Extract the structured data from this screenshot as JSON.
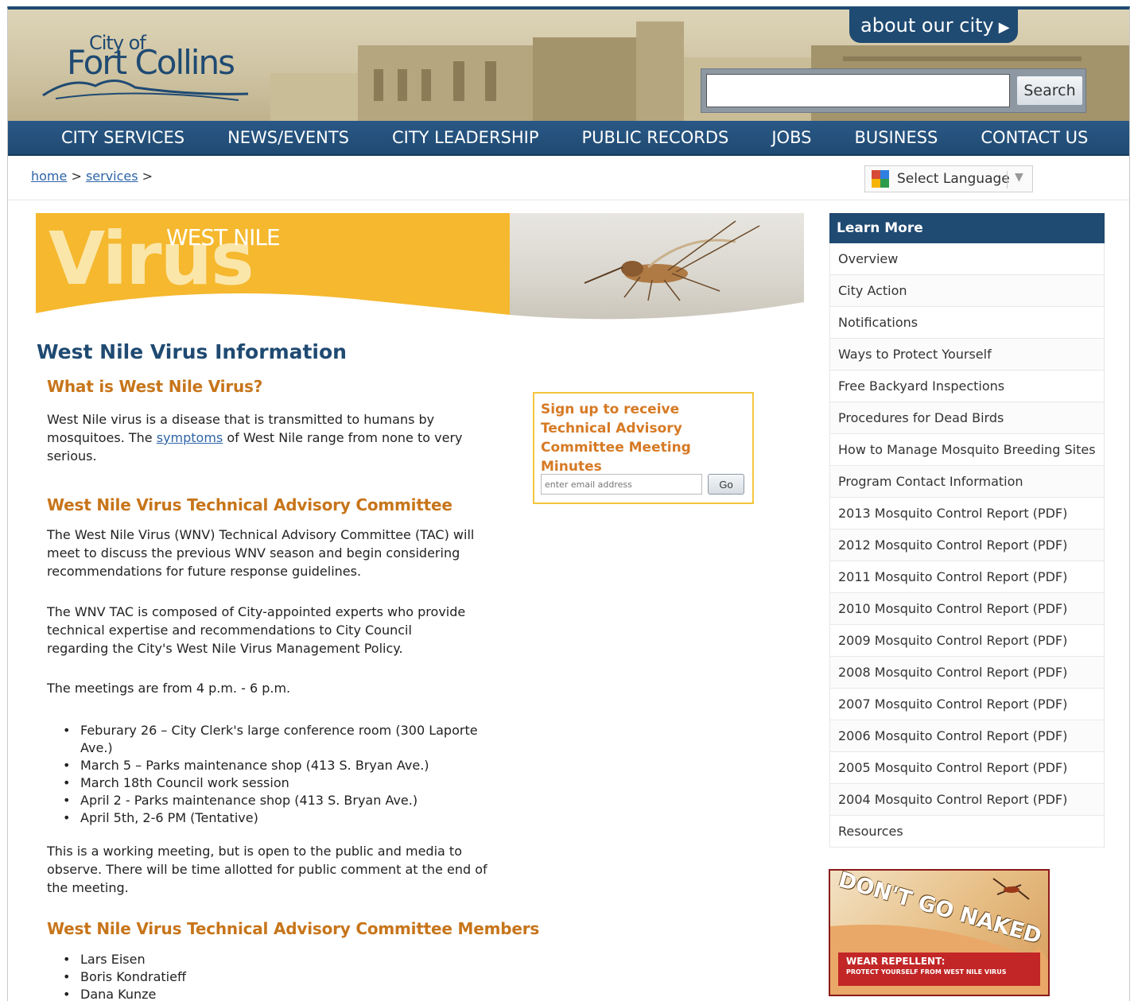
{
  "header": {
    "logo_city_of": "City of",
    "logo_fort_collins": "Fort Collins",
    "about_tab": "about our city",
    "search_placeholder": "",
    "search_button": "Search"
  },
  "nav": {
    "items": [
      "CITY SERVICES",
      "NEWS/EVENTS",
      "CITY LEADERSHIP",
      "PUBLIC RECORDS",
      "JOBS",
      "BUSINESS",
      "CONTACT US"
    ]
  },
  "breadcrumb": {
    "home": "home",
    "sep1": " > ",
    "services": "services",
    "sep2": " >"
  },
  "language": {
    "label": "Select Language"
  },
  "banner": {
    "line1": "WEST NILE",
    "line2": "Virus"
  },
  "main": {
    "title": "West Nile Virus Information",
    "what_heading": "What is West Nile Virus?",
    "what_p_1": "West Nile virus is a disease that is transmitted to humans by mosquitoes. The ",
    "what_link": "symptoms",
    "what_p_2": " of West Nile range from none to very serious.",
    "tac_heading": "West Nile Virus Technical Advisory Committee",
    "tac_p1": "The West Nile Virus (WNV) Technical Advisory Committee (TAC) will meet to discuss the previous WNV season and begin considering recommendations for future response guidelines.",
    "tac_p2": "The WNV TAC is composed of City-appointed experts who provide technical expertise and recommendations to City Council regarding the City's West Nile Virus Management Policy.",
    "tac_p3": "The meetings are from 4 p.m. - 6 p.m.",
    "meetings": [
      "Feburary 26 – City Clerk's large conference room (300 Laporte Ave.)",
      "March 5 – Parks maintenance shop (413 S. Bryan Ave.)",
      "March 18th Council work session",
      "April 2 - Parks maintenance shop (413 S. Bryan Ave.)",
      "April 5th, 2-6 PM (Tentative)"
    ],
    "tac_p4": "This is a working meeting, but is open to the public and media to observe. There will be time allotted for public comment at the end of the meeting.",
    "members_heading": "West Nile Virus Technical Advisory Committee Members",
    "members": [
      "Lars Eisen",
      "Boris Kondratieff",
      "Dana Kunze"
    ]
  },
  "signup": {
    "title": "Sign up to receive Technical Advisory Committee Meeting Minutes",
    "email_placeholder": "enter email address",
    "go_button": "Go"
  },
  "sidebar": {
    "heading": "Learn More",
    "items": [
      "Overview",
      "City Action",
      "Notifications",
      "Ways to Protect Yourself",
      "Free Backyard Inspections",
      "Procedures for Dead Birds",
      "How to Manage Mosquito Breeding Sites",
      "Program Contact Information",
      "2013 Mosquito Control Report (PDF)",
      "2012 Mosquito Control Report (PDF)",
      "2011 Mosquito Control Report (PDF)",
      "2010 Mosquito Control Report (PDF)",
      "2009 Mosquito Control Report (PDF)",
      "2008 Mosquito Control Report (PDF)",
      "2007 Mosquito Control Report (PDF)",
      "2006 Mosquito Control Report (PDF)",
      "2005 Mosquito Control Report (PDF)",
      "2004 Mosquito Control Report (PDF)",
      "Resources"
    ]
  },
  "ad": {
    "headline": "DON'T GO NAKED",
    "bar_line1": "WEAR REPELLENT:",
    "bar_line2": "PROTECT YOURSELF FROM WEST NILE VIRUS"
  },
  "colors": {
    "brand_blue": "#1f4a72",
    "heading_orange": "#c7751a",
    "banner_gold": "#f5b82e",
    "link_blue": "#2e64a8"
  }
}
